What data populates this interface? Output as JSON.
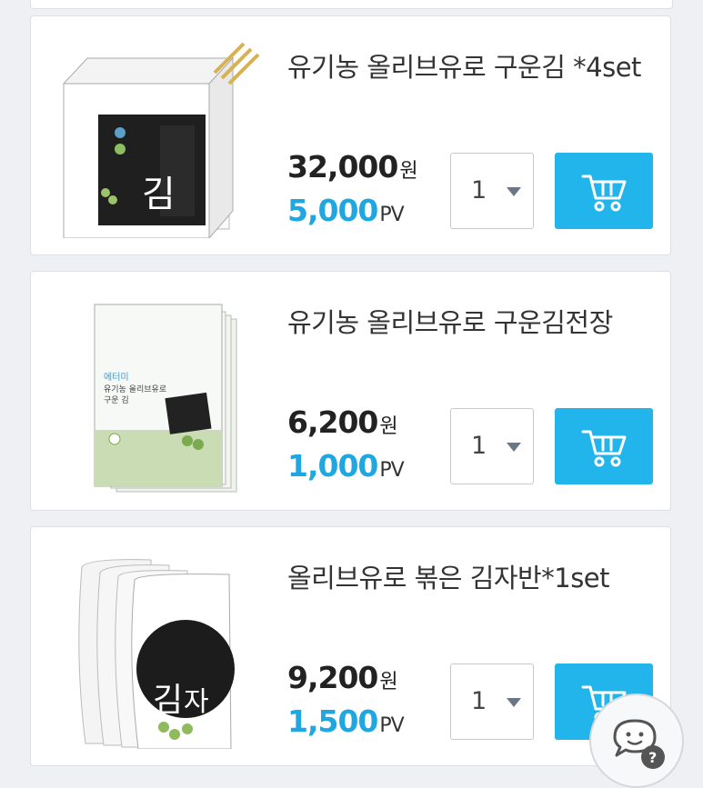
{
  "colors": {
    "accent": "#22b5ec",
    "pv_text": "#1ea7e1",
    "page_bg": "#eef0f3",
    "card_bg": "#ffffff"
  },
  "products": [
    {
      "title": "유기농 올리브유로 구운김 *4set",
      "price": "32,000",
      "price_unit": "원",
      "pv": "5,000",
      "pv_unit": "PV",
      "quantity": "1",
      "image_kind": "boxed seaweed set"
    },
    {
      "title": "유기농 올리브유로 구운김전장",
      "price": "6,200",
      "price_unit": "원",
      "pv": "1,000",
      "pv_unit": "PV",
      "quantity": "1",
      "image_kind": "seaweed sheet packs"
    },
    {
      "title": "올리브유로 볶은 김자반*1set",
      "price": "9,200",
      "price_unit": "원",
      "pv": "1,500",
      "pv_unit": "PV",
      "quantity": "1",
      "image_kind": "seaweed flakes pouches"
    }
  ],
  "icons": {
    "cart": "cart-icon",
    "dropdown": "chevron-down-icon",
    "chat": "chat-bubble-icon"
  }
}
